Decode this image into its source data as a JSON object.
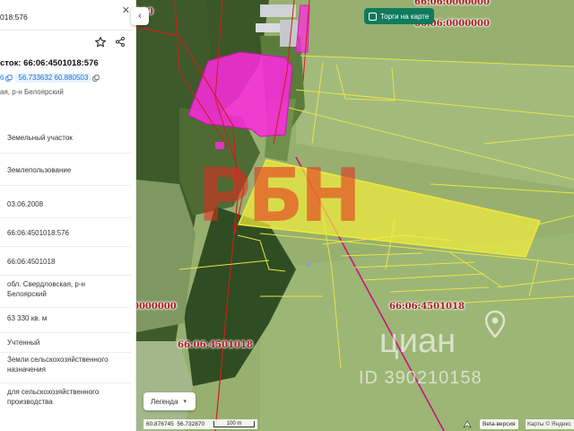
{
  "search": {
    "query": "018:576"
  },
  "card": {
    "title": "сток: 66:06:4501018:576",
    "link_fragment": "6",
    "coordinates": "56.733632 60.880503",
    "address": "ая, р-н Белоярский"
  },
  "details": [
    {
      "value": "Земельный участок"
    },
    {
      "value": "Землепользование"
    },
    {
      "value": "03.06.2008"
    },
    {
      "value": "66:06:4501018:576"
    },
    {
      "value": "66:06:4501018"
    },
    {
      "value": "обл. Свердловская, р-н Белоярский"
    },
    {
      "value": "63 330 кв. м"
    },
    {
      "value": "Учтенный"
    },
    {
      "value": "Земли сельскохозяйственного назначения"
    },
    {
      "value": "для сельскохозяйственного производства"
    }
  ],
  "map": {
    "torgi_label": "Торги на карте",
    "legend_label": "Легенда",
    "cadastral_labels": {
      "top_partial": "66:06:0000000",
      "right_partial": "66:06:0000000",
      "left_partial": "0000000",
      "center": "66:06:4501018",
      "lower_left": "66:06:4501018",
      "top_left_partial": "000"
    },
    "footer": {
      "lon": "60.876745",
      "lat": "56.732870",
      "scale": "100 m",
      "beta": "Beta-версия",
      "copyright": "Карты © Яндекс"
    },
    "watermarks": {
      "pbh": "РБН",
      "cian": "циан",
      "cian_id": "ID 390210158"
    },
    "colors": {
      "selected_parcel": "#f2f23c",
      "parcel_outline": "#e8e44a",
      "zone_fill": "#ff29e0",
      "cadastral_text": "#a8191b",
      "torgi_bg": "#0f7a5c"
    }
  }
}
